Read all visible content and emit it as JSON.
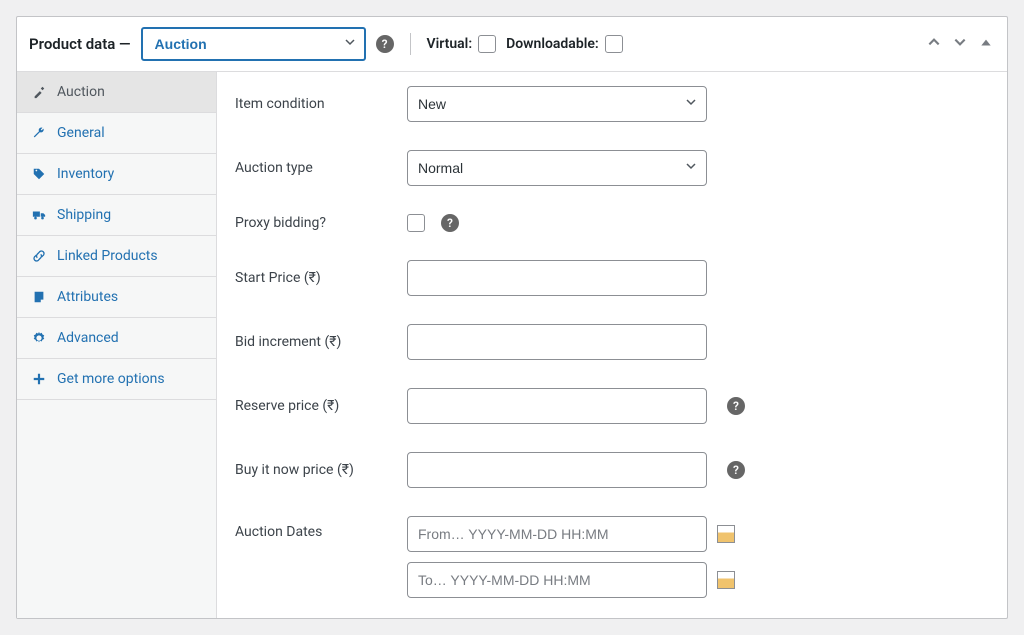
{
  "header": {
    "title": "Product data —",
    "product_type": "Auction",
    "virtual_label": "Virtual:",
    "downloadable_label": "Downloadable:"
  },
  "tabs": [
    {
      "label": "Auction",
      "icon": "hammer",
      "active": true,
      "name": "tab-auction"
    },
    {
      "label": "General",
      "icon": "wrench",
      "active": false,
      "name": "tab-general"
    },
    {
      "label": "Inventory",
      "icon": "tag",
      "active": false,
      "name": "tab-inventory"
    },
    {
      "label": "Shipping",
      "icon": "truck",
      "active": false,
      "name": "tab-shipping"
    },
    {
      "label": "Linked Products",
      "icon": "link",
      "active": false,
      "name": "tab-linked-products"
    },
    {
      "label": "Attributes",
      "icon": "note",
      "active": false,
      "name": "tab-attributes"
    },
    {
      "label": "Advanced",
      "icon": "gear",
      "active": false,
      "name": "tab-advanced"
    },
    {
      "label": "Get more options",
      "icon": "plus",
      "active": false,
      "name": "tab-get-more-options"
    }
  ],
  "fields": {
    "item_condition": {
      "label": "Item condition",
      "value": "New"
    },
    "auction_type": {
      "label": "Auction type",
      "value": "Normal"
    },
    "proxy_bidding": {
      "label": "Proxy bidding?",
      "checked": false
    },
    "start_price": {
      "label": "Start Price (₹)",
      "value": ""
    },
    "bid_increment": {
      "label": "Bid increment (₹)",
      "value": ""
    },
    "reserve_price": {
      "label": "Reserve price (₹)",
      "value": ""
    },
    "buy_now_price": {
      "label": "Buy it now price (₹)",
      "value": ""
    },
    "auction_dates": {
      "label": "Auction Dates",
      "from_placeholder": "From… YYYY-MM-DD HH:MM",
      "to_placeholder": "To… YYYY-MM-DD HH:MM"
    }
  }
}
